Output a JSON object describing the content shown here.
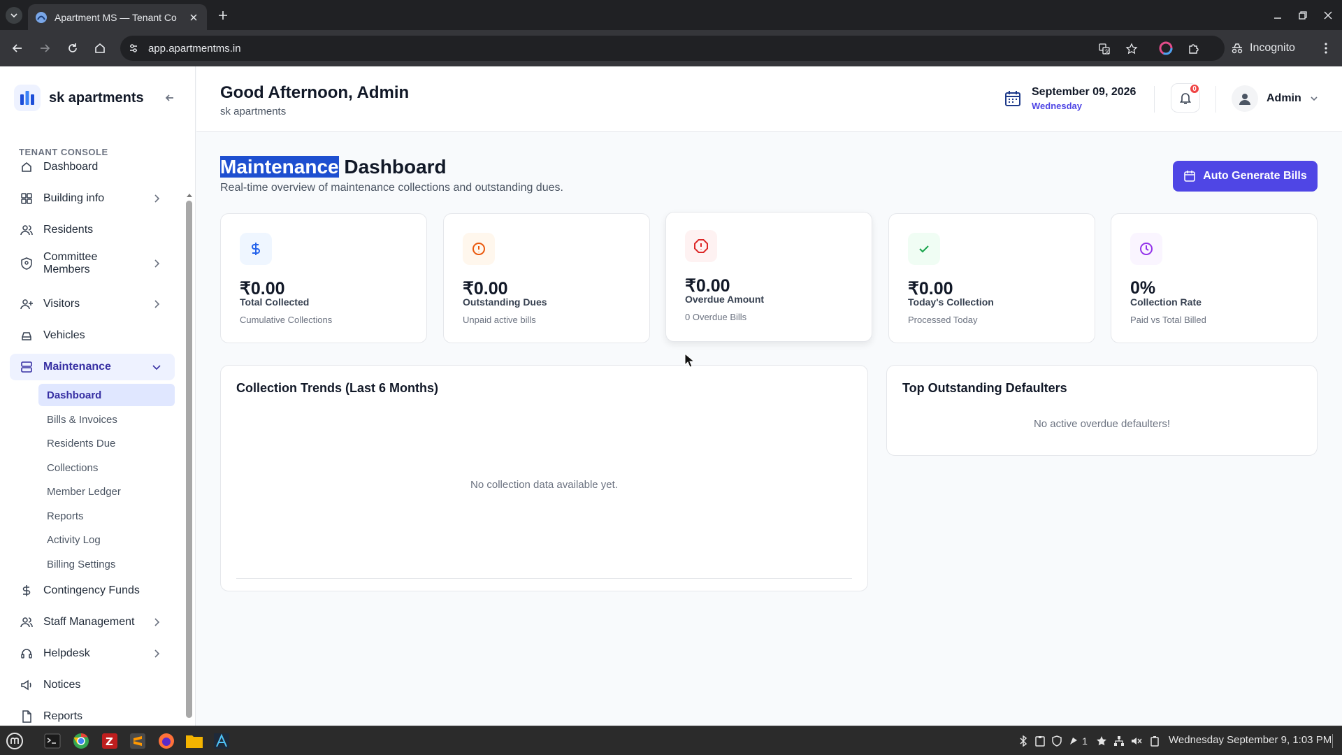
{
  "browser": {
    "tab_title": "Apartment MS — Tenant Co",
    "url": "app.apartmentms.in",
    "profile_label": "Incognito"
  },
  "brand": {
    "name": "sk apartments"
  },
  "sidebar": {
    "section_label": "TENANT CONSOLE",
    "items": [
      {
        "label": "Dashboard",
        "icon": "home-icon"
      },
      {
        "label": "Building info",
        "icon": "grid-icon",
        "has_children": true
      },
      {
        "label": "Residents",
        "icon": "users-icon"
      },
      {
        "label": "Committee Members",
        "icon": "shield-icon",
        "has_children": true
      },
      {
        "label": "Visitors",
        "icon": "user-plus-icon",
        "has_children": true
      },
      {
        "label": "Vehicles",
        "icon": "car-icon"
      },
      {
        "label": "Maintenance",
        "icon": "server-icon",
        "has_children": true,
        "expanded": true,
        "active": true
      },
      {
        "label": "Contingency Funds",
        "icon": "dollar-icon"
      },
      {
        "label": "Staff Management",
        "icon": "users-icon",
        "has_children": true
      },
      {
        "label": "Helpdesk",
        "icon": "headset-icon",
        "has_children": true
      },
      {
        "label": "Notices",
        "icon": "megaphone-icon"
      },
      {
        "label": "Reports",
        "icon": "file-icon"
      }
    ],
    "maintenance_sub": [
      {
        "label": "Dashboard",
        "active": true
      },
      {
        "label": "Bills & Invoices"
      },
      {
        "label": "Residents Due"
      },
      {
        "label": "Collections"
      },
      {
        "label": "Member Ledger"
      },
      {
        "label": "Reports"
      },
      {
        "label": "Activity Log"
      },
      {
        "label": "Billing Settings"
      }
    ]
  },
  "header": {
    "greeting": "Good Afternoon, Admin",
    "subtitle": "sk apartments",
    "date": "September 09, 2026",
    "weekday": "Wednesday",
    "notification_count": "0",
    "user_name": "Admin"
  },
  "page": {
    "title_highlight": "Maintenance",
    "title_rest": " Dashboard",
    "subtitle": "Real-time overview of maintenance collections and outstanding dues.",
    "primary_button": "Auto Generate Bills"
  },
  "stats": [
    {
      "value": "₹0.00",
      "label": "Total Collected",
      "sub": "Cumulative Collections",
      "icon": "dollar-icon",
      "color": "#2563eb",
      "bg": "#eff6ff"
    },
    {
      "value": "₹0.00",
      "label": "Outstanding Dues",
      "sub": "Unpaid active bills",
      "icon": "alert-circle-icon",
      "color": "#ea580c",
      "bg": "#fff7ed"
    },
    {
      "value": "₹0.00",
      "label": "Overdue Amount",
      "sub": "0 Overdue Bills",
      "icon": "alert-octagon-icon",
      "color": "#dc2626",
      "bg": "#fef2f2"
    },
    {
      "value": "₹0.00",
      "label": "Today's Collection",
      "sub": "Processed Today",
      "icon": "check-icon",
      "color": "#16a34a",
      "bg": "#f0fdf4"
    },
    {
      "value": "0%",
      "label": "Collection Rate",
      "sub": "Paid vs Total Billed",
      "icon": "clock-icon",
      "color": "#9333ea",
      "bg": "#faf5ff"
    }
  ],
  "trends": {
    "title": "Collection Trends (Last 6 Months)",
    "empty": "No collection data available yet."
  },
  "defaulters": {
    "title": "Top Outstanding Defaulters",
    "empty": "No active overdue defaulters!"
  },
  "taskbar": {
    "clock": "Wednesday September 9, 1:03 PM",
    "workspace": "1"
  },
  "colors": {
    "accent": "#4f46e5",
    "sidebar_active_bg": "#eef2ff",
    "selection": "#1e4fd0"
  }
}
